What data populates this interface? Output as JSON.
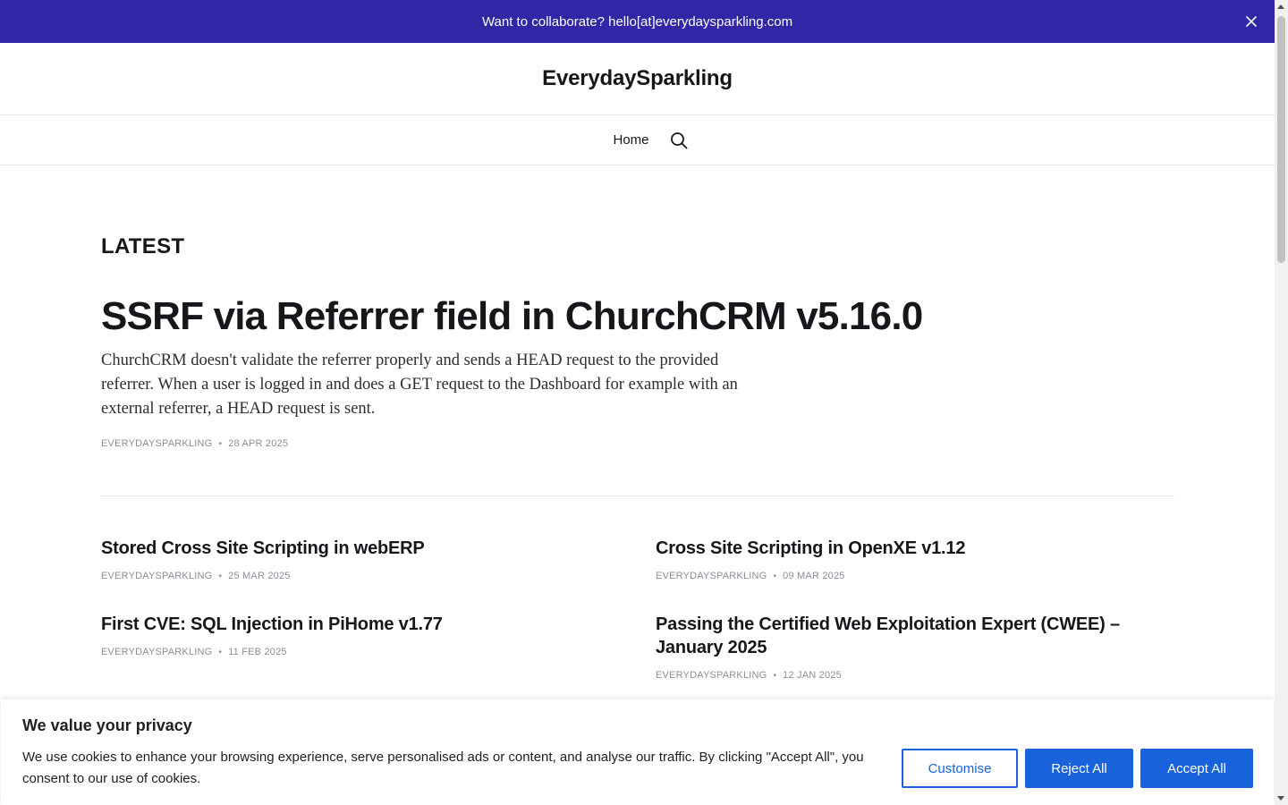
{
  "announcement": {
    "text": "Want to collaborate? hello[at]everydaysparkling.com",
    "close_icon": "close-icon"
  },
  "header": {
    "site_title": "EverydaySparkling"
  },
  "nav": {
    "home_label": "Home",
    "search_icon": "search-icon"
  },
  "main": {
    "section_title": "LATEST",
    "featured": {
      "title": "SSRF via Referrer field in ChurchCRM v5.16.0",
      "excerpt": "ChurchCRM doesn't validate the referrer properly and sends a HEAD request to the provided referrer. When a user is logged in and does a GET request to the Dashboard for example with an external referrer, a HEAD request is sent.",
      "author": "EVERYDAYSPARKLING",
      "date": "28 APR 2025"
    },
    "posts": [
      {
        "title": "Stored Cross Site Scripting in webERP",
        "author": "EVERYDAYSPARKLING",
        "date": "25 MAR 2025"
      },
      {
        "title": "Cross Site Scripting in OpenXE v1.12",
        "author": "EVERYDAYSPARKLING",
        "date": "09 MAR 2025"
      },
      {
        "title": "First CVE: SQL Injection in PiHome v1.77",
        "author": "EVERYDAYSPARKLING",
        "date": "11 FEB 2025"
      },
      {
        "title": "Passing the Certified Web Exploitation Expert (CWEE) – January 2025",
        "author": "EVERYDAYSPARKLING",
        "date": "12 JAN 2025"
      }
    ],
    "meta_separator": "•"
  },
  "cookie_banner": {
    "heading": "We value your privacy",
    "text": "We use cookies to enhance your browsing experience, serve personalised ads or content, and analyse our traffic. By clicking \"Accept All\", you consent to our use of cookies.",
    "customise_label": "Customise",
    "reject_label": "Reject All",
    "accept_label": "Accept All"
  },
  "colors": {
    "announcement_bg": "#3127a6",
    "cookie_button": "#1863dc",
    "text": "#15171a",
    "meta": "#8a8f96"
  }
}
